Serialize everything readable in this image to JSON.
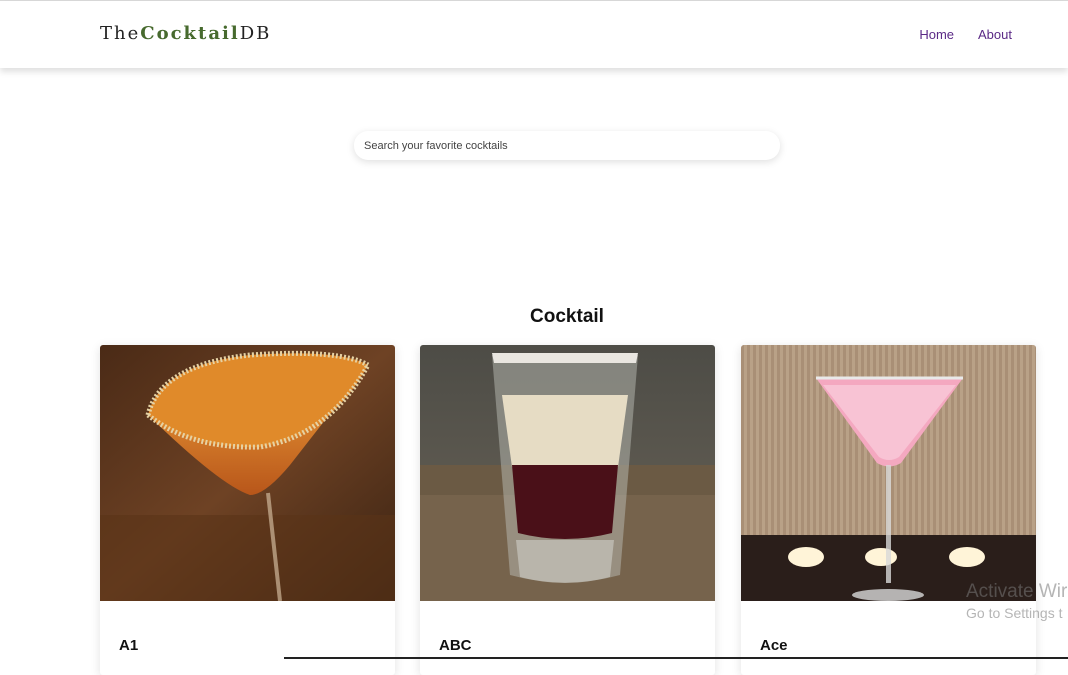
{
  "brand": {
    "prefix": "The",
    "accent": "Cocktail",
    "suffix": "DB",
    "accent_color": "#476a2e"
  },
  "nav": {
    "links": [
      {
        "label": "Home"
      },
      {
        "label": "About"
      }
    ],
    "link_color": "#5b2a86"
  },
  "search": {
    "placeholder": "Search your favorite cocktails",
    "value": ""
  },
  "section": {
    "title": "Cocktail"
  },
  "cocktails": [
    {
      "name": "A1",
      "image": "orange-martini-with-sugared-rim"
    },
    {
      "name": "ABC",
      "image": "layered-shot-glass-cream-over-red"
    },
    {
      "name": "Ace",
      "image": "pink-martini-with-candles"
    }
  ],
  "os_watermark": {
    "line1": "Activate Wir",
    "line2": "Go to Settings t"
  }
}
